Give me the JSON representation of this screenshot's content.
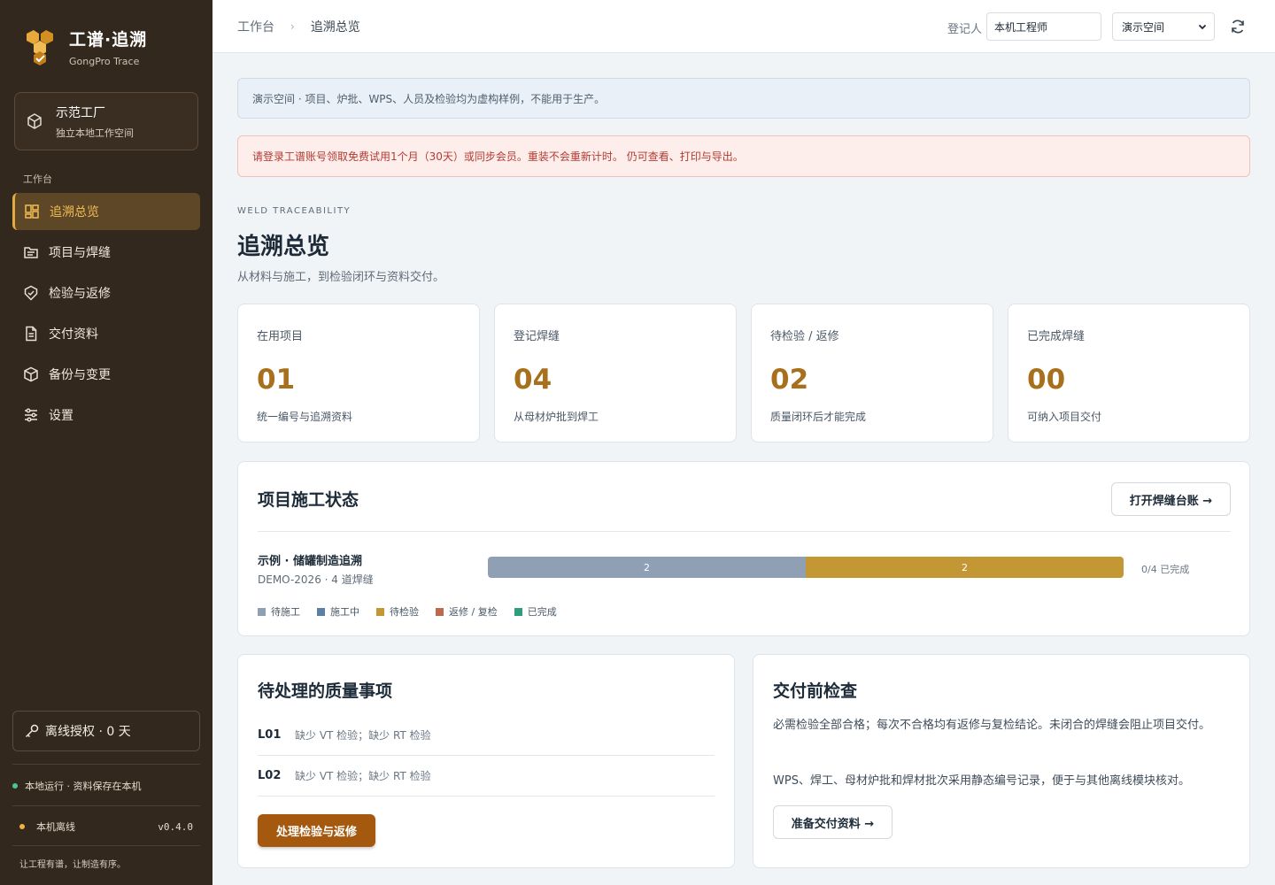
{
  "brand": {
    "title": "工谱·追溯",
    "subtitle": "GongPro Trace"
  },
  "workspace": {
    "title": "示范工厂",
    "subtitle": "独立本地工作空间"
  },
  "sidebar": {
    "section_label": "工作台",
    "items": [
      {
        "label": "追溯总览",
        "icon": "dashboard-icon",
        "active": true
      },
      {
        "label": "项目与焊缝",
        "icon": "folder-icon",
        "active": false
      },
      {
        "label": "检验与返修",
        "icon": "shield-check-icon",
        "active": false
      },
      {
        "label": "交付资料",
        "icon": "document-icon",
        "active": false
      },
      {
        "label": "备份与变更",
        "icon": "box-icon",
        "active": false
      },
      {
        "label": "设置",
        "icon": "sliders-icon",
        "active": false
      }
    ],
    "license": "离线授权 · 0 天",
    "local_status": "本地运行 · 资料保存在本机",
    "offline": "本机离线",
    "version": "v0.4.0",
    "slogan": "让工程有谱，让制造有序。"
  },
  "header": {
    "breadcrumb_root": "工作台",
    "breadcrumb_sep": "›",
    "breadcrumb_current": "追溯总览",
    "recorder_label": "登记人",
    "recorder_value": "本机工程师",
    "space_value": "演示空间"
  },
  "notices": {
    "demo": "演示空间 · 项目、炉批、WPS、人员及检验均为虚构样例，不能用于生产。",
    "trial": "请登录工谱账号领取免费试用1个月（30天）或同步会员。重装不会重新计时。 仍可查看、打印与导出。"
  },
  "page": {
    "eyebrow": "WELD TRACEABILITY",
    "title": "追溯总览",
    "subtitle": "从材料与施工，到检验闭环与资料交付。"
  },
  "stats": [
    {
      "label": "在用项目",
      "value": "01",
      "desc": "统一编号与追溯资料"
    },
    {
      "label": "登记焊缝",
      "value": "04",
      "desc": "从母材炉批到焊工"
    },
    {
      "label": "待检验 / 返修",
      "value": "02",
      "desc": "质量闭环后才能完成"
    },
    {
      "label": "已完成焊缝",
      "value": "00",
      "desc": "可纳入项目交付"
    }
  ],
  "project_status": {
    "title": "项目施工状态",
    "button": "打开焊缝台账 →",
    "project": {
      "name": "示例 · 储罐制造追溯",
      "meta": "DEMO-2026 · 4 道焊缝",
      "segments": [
        {
          "status": "待施工",
          "count": 2
        },
        {
          "status": "待检验",
          "count": 2
        }
      ],
      "total": 4,
      "progress_text": "0/4 已完成"
    },
    "legend": [
      {
        "label": "待施工",
        "color": "#8fa0b4"
      },
      {
        "label": "施工中",
        "color": "#5b80a5"
      },
      {
        "label": "待检验",
        "color": "#c39734"
      },
      {
        "label": "返修 / 复检",
        "color": "#bb6a4e"
      },
      {
        "label": "已完成",
        "color": "#2f9c7e"
      }
    ]
  },
  "quality": {
    "title": "待处理的质量事项",
    "issues": [
      {
        "id": "L01",
        "text": "缺少 VT 检验；缺少 RT 检验"
      },
      {
        "id": "L02",
        "text": "缺少 VT 检验；缺少 RT 检验"
      }
    ],
    "button": "处理检验与返修"
  },
  "delivery": {
    "title": "交付前检查",
    "para1": "必需检验全部合格；每次不合格均有返修与复检结论。未闭合的焊缝会阻止项目交付。",
    "para2": "WPS、焊工、母材炉批和焊材批次采用静态编号记录，便于与其他离线模块核对。",
    "button": "准备交付资料 →"
  },
  "colors": {
    "sidebar_bg": "#33281d",
    "accent": "#e5aa40",
    "stat_value": "#a86f1d",
    "primary_button": "#a4590f"
  }
}
